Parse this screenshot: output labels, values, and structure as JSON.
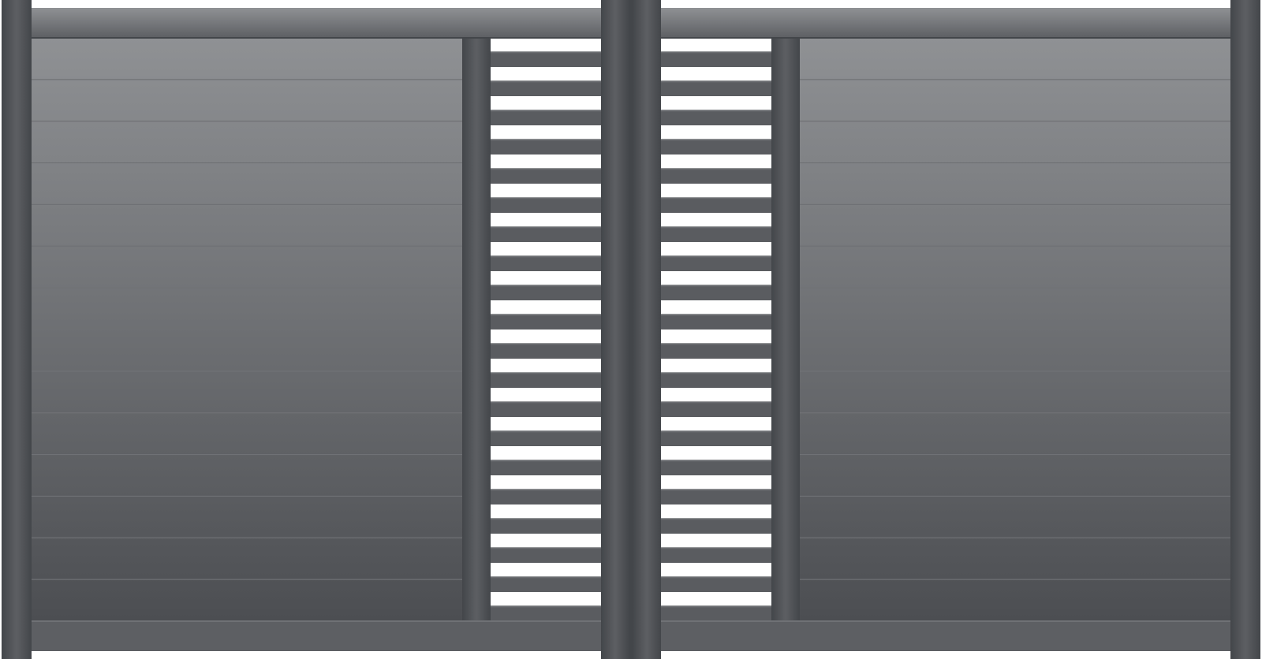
{
  "image": {
    "subject": "double-leaf-gate",
    "colors": {
      "background": "#ffffff",
      "frame": "#5d5f63",
      "frame_edge": "#43464a",
      "panel_top": "#8f9194",
      "panel_bottom": "#4c4e52",
      "slat": "#5a5c60",
      "slat_top": "#6b6d71",
      "gap": "#ffffff",
      "seam": "#6f7175"
    },
    "leaves": [
      {
        "name": "left-leaf",
        "solid_slats": 14,
        "openwork_slats": 20
      },
      {
        "name": "right-leaf",
        "solid_slats": 14,
        "openwork_slats": 20
      }
    ]
  }
}
